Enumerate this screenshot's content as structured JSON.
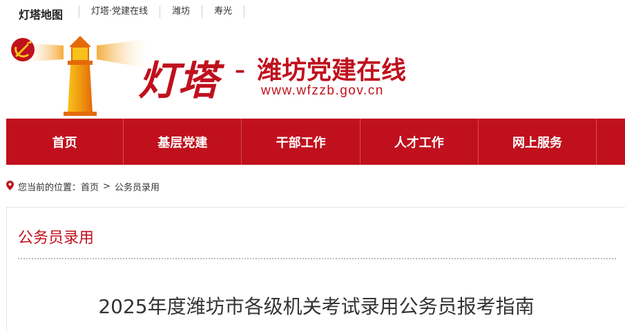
{
  "topbar": {
    "brand": "灯塔地图",
    "links": [
      "灯塔·党建在线",
      "潍坊",
      "寿光"
    ]
  },
  "banner": {
    "logo_calligraphy": "灯塔",
    "dash": "–",
    "site_name": "潍坊党建在线",
    "url": "www.wfzzb.gov.cn",
    "colors": {
      "red": "#c0101d",
      "gold": "#f7a300"
    }
  },
  "nav": {
    "items": [
      "首页",
      "基层党建",
      "干部工作",
      "人才工作",
      "网上服务"
    ],
    "bg_color": "#c0101d"
  },
  "breadcrumb": {
    "prefix": "您当前的位置：",
    "home": "首页",
    "separator": ">",
    "current": "公务员录用",
    "icon": "map-pin-icon"
  },
  "content": {
    "section_title": "公务员录用",
    "article_title": "2025年度潍坊市各级机关考试录用公务员报考指南"
  }
}
